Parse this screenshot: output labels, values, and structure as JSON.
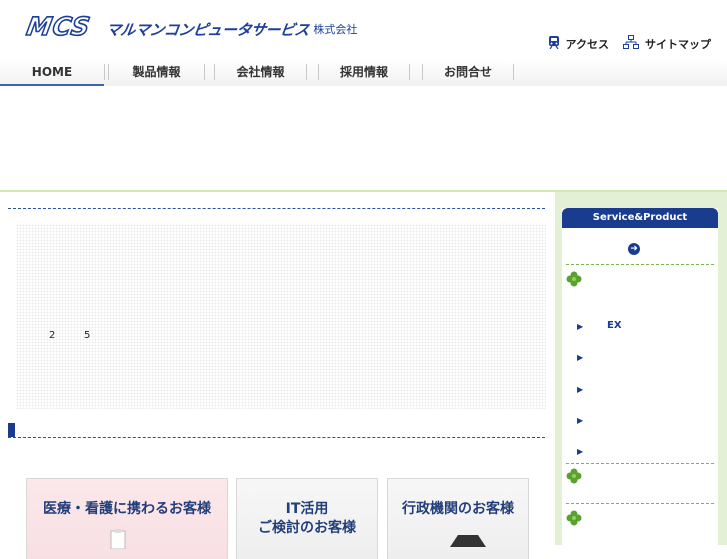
{
  "header": {
    "logo_mark": "MCS",
    "logo_name": "マルマンコンピュータサービス",
    "logo_suffix": "株式会社",
    "util": [
      {
        "label": "アクセス",
        "icon": "train-icon"
      },
      {
        "label": "サイトマップ",
        "icon": "sitemap-icon"
      }
    ]
  },
  "nav": {
    "tabs": [
      {
        "label": "HOME",
        "active": true
      },
      {
        "label": "製品情報"
      },
      {
        "label": "会社情報"
      },
      {
        "label": "採用情報"
      },
      {
        "label": "お問合せ"
      }
    ]
  },
  "main": {
    "numbers": [
      "2",
      "5"
    ],
    "cards": [
      {
        "title": "医療・看護に携わるお客様"
      },
      {
        "title_line1": "IT活用",
        "title_line2": "ご検討のお客様"
      },
      {
        "title": "行政機関のお客様"
      }
    ]
  },
  "sidebar": {
    "heading": "Service&Product",
    "items": [
      {
        "label": "EX"
      }
    ]
  },
  "colors": {
    "brand": "#1b3f9a",
    "nav_active": "#3e63a8",
    "side_bg": "#e4f0d6",
    "clover": "#5aa12f"
  }
}
